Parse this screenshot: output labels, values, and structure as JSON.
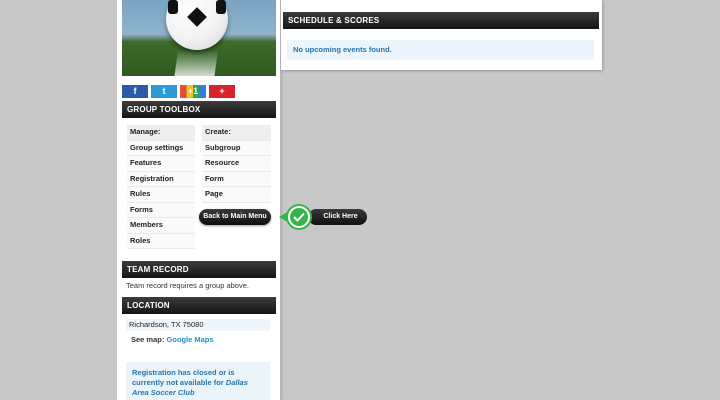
{
  "share": {
    "facebook": "f",
    "twitter": "t",
    "gplus": "+1",
    "more": "+"
  },
  "toolbox": {
    "title": "GROUP TOOLBOX",
    "manage": {
      "header": "Manage:",
      "items": [
        "Group settings",
        "Features",
        "Registration",
        "Rules",
        "Forms",
        "Members",
        "Roles"
      ]
    },
    "create": {
      "header": "Create:",
      "items": [
        "Subgroup",
        "Resource",
        "Form",
        "Page"
      ]
    },
    "back_button": "Back to Main Menu",
    "click_here": "Click Here"
  },
  "team_record": {
    "title": "TEAM RECORD",
    "text": "Team record requires a group above."
  },
  "location": {
    "title": "LOCATION",
    "address": "Richardson, TX 75080",
    "see_map_label": "See map:",
    "map_link": "Google Maps"
  },
  "registration": {
    "text_prefix": "Registration has closed or is currently not available for",
    "club": "Dallas Area Soccer Club"
  },
  "schedule": {
    "title": "SCHEDULE & SCORES",
    "empty": "No upcoming events found."
  },
  "colors": {
    "accent_green": "#35b44a",
    "link_blue": "#1f8fce",
    "notice_text": "#2a76a9",
    "notice_bg": "#eaf5fc"
  }
}
